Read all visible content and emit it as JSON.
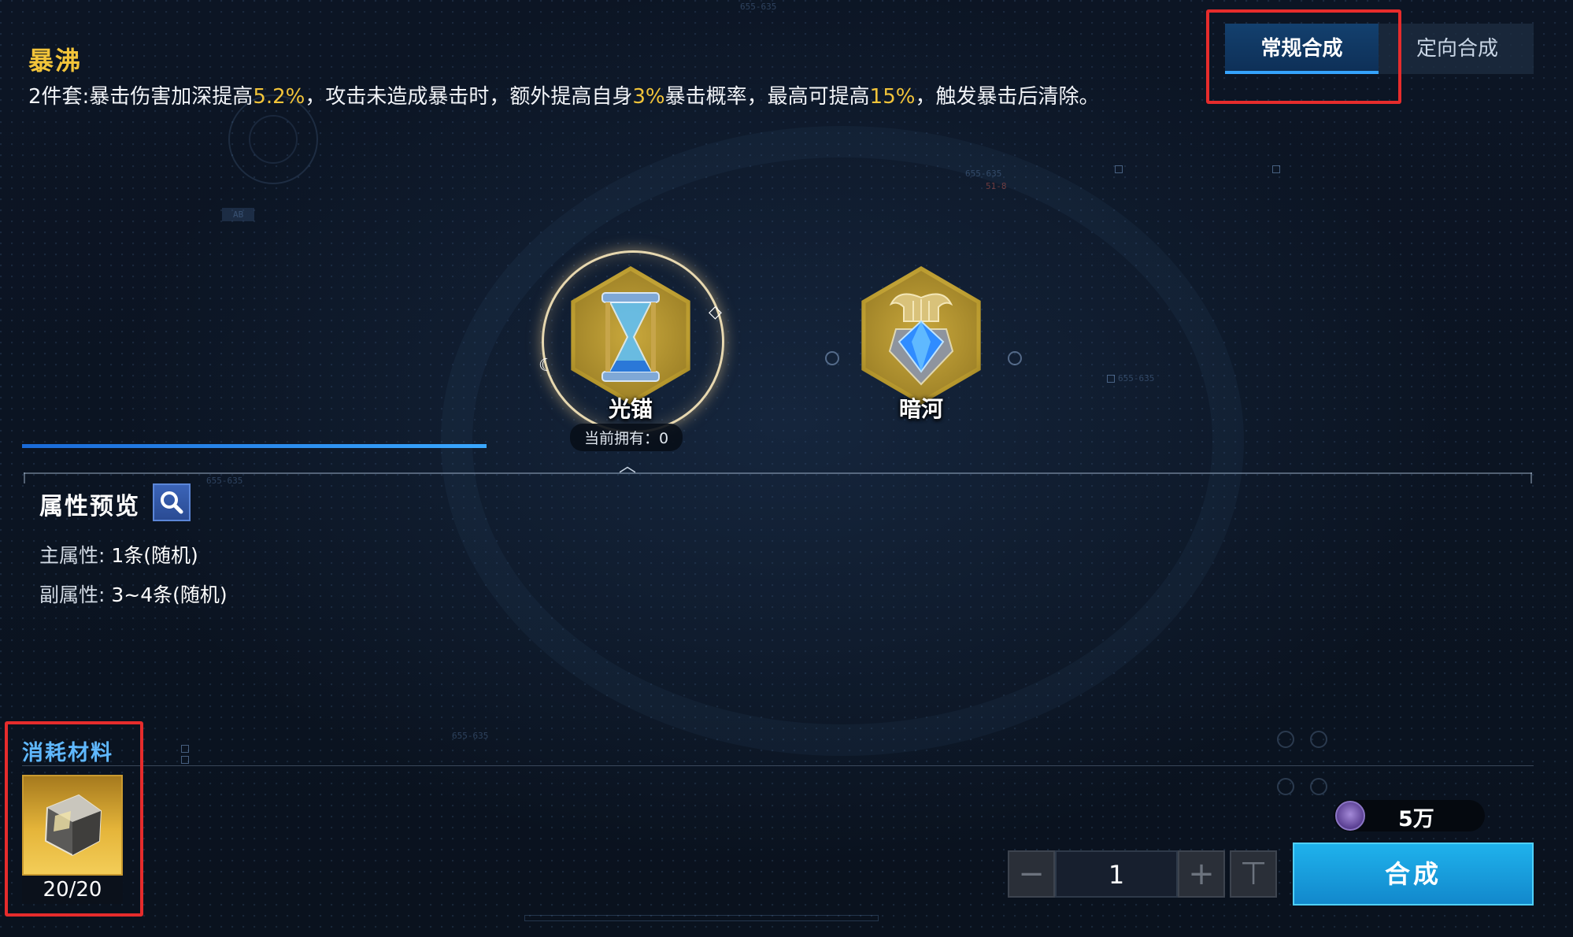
{
  "set": {
    "name": "暴沸",
    "desc_parts": [
      "2件套:暴击伤害加深提高",
      "5.2%",
      "，攻击未造成暴击时，额外提高自身",
      "3%",
      "暴击概率，最高可提高",
      "15%",
      "，触发暴击后清除。"
    ]
  },
  "tabs": [
    {
      "label": "常规合成",
      "selected": true
    },
    {
      "label": "定向合成",
      "selected": false
    }
  ],
  "items": [
    {
      "name": "光锚",
      "owned": "当前拥有：0",
      "selected": true,
      "icon": "hourglass-icon"
    },
    {
      "name": "暗河",
      "selected": false,
      "icon": "lyre-gem-icon"
    }
  ],
  "attributes": {
    "title": "属性预览",
    "main_label": "主属性:",
    "main_value": "1条(随机)",
    "sub_label": "副属性:",
    "sub_value": "3~4条(随机)"
  },
  "materials": {
    "title": "消耗材料",
    "count": "20/20",
    "icon": "ore-chunk-icon"
  },
  "craft": {
    "cost": "5万",
    "quantity": "1",
    "button_label": "合成",
    "minus_glyph": "−",
    "plus_glyph": "+",
    "max_glyph": "⊤"
  },
  "deco": {
    "code1": "655-635",
    "code2": "51-8",
    "code3": "AB"
  },
  "colors": {
    "accent_gold": "#f2c43a",
    "accent_blue": "#35a4ff",
    "highlight_box": "#e62c2c",
    "craft_button": "#1fb2ec"
  }
}
